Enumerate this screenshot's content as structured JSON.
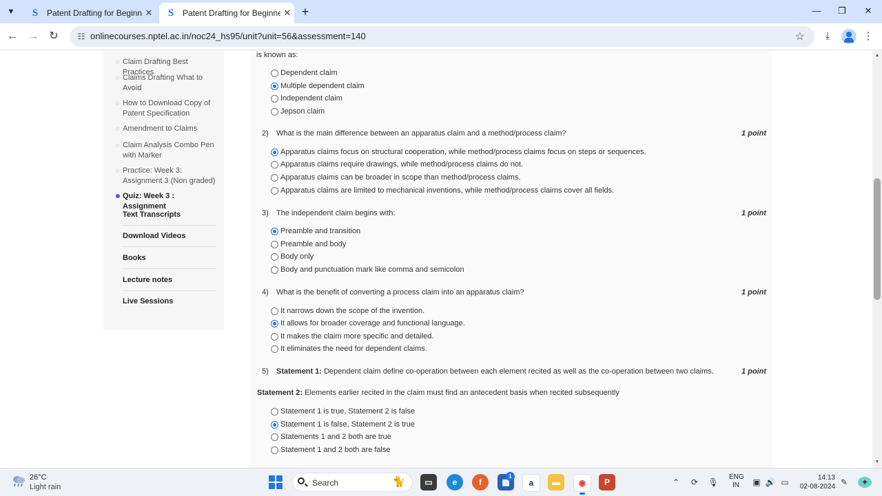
{
  "browser": {
    "tabs": [
      {
        "title": "Patent Drafting for Beginners -",
        "favicon": "S",
        "active": false
      },
      {
        "title": "Patent Drafting for Beginners -",
        "favicon": "S",
        "active": true
      }
    ],
    "url": "onlinecourses.nptel.ac.in/noc24_hs95/unit?unit=56&assessment=140",
    "accent_color": "#1a73e8"
  },
  "sidebar": {
    "subitems": [
      {
        "label": "Claim Drafting Best Practices",
        "active": false
      },
      {
        "label": "Claims Drafting What to Avoid",
        "active": false
      },
      {
        "label": "How to Download Copy of Patent Specification",
        "active": false
      },
      {
        "label": "Amendment to Claims",
        "active": false
      },
      {
        "label": "Claim Analysis Combo Pen with Marker",
        "active": false
      },
      {
        "label": "Practice: Week 3: Assignment 3 (Non graded)",
        "active": false
      },
      {
        "label": "Quiz: Week 3 : Assignment",
        "active": true
      }
    ],
    "sections": [
      "Text Transcripts",
      "Download Videos",
      "Books",
      "Lecture notes",
      "Live Sessions"
    ]
  },
  "quiz": {
    "partial_top": "is known as:",
    "q1_options": [
      {
        "text": "Dependent claim",
        "checked": false
      },
      {
        "text": "Multiple dependent claim",
        "checked": true
      },
      {
        "text": "Independent claim",
        "checked": false
      },
      {
        "text": "Jepson claim",
        "checked": false
      }
    ],
    "questions": [
      {
        "num": "2)",
        "text": "What is the main difference between an apparatus claim and a method/process claim?",
        "points": "1 point",
        "options": [
          {
            "text": "Apparatus claims focus on structural cooperation, while method/process claims focus on steps or sequences.",
            "checked": true
          },
          {
            "text": "Apparatus claims require drawings, while method/process claims do not.",
            "checked": false
          },
          {
            "text": "Apparatus claims can be broader in scope than method/process claims.",
            "checked": false
          },
          {
            "text": "Apparatus claims are limited to mechanical inventions, while method/process claims cover all fields.",
            "checked": false
          }
        ]
      },
      {
        "num": "3)",
        "text": "The independent claim begins with:",
        "points": "1 point",
        "options": [
          {
            "text": "Preamble and transition",
            "checked": true
          },
          {
            "text": "Preamble and body",
            "checked": false
          },
          {
            "text": "Body only",
            "checked": false
          },
          {
            "text": "Body and punctuation mark like comma and semicolon",
            "checked": false
          }
        ]
      },
      {
        "num": "4)",
        "text": "What is the benefit of converting a process claim into an apparatus claim?",
        "points": "1 point",
        "options": [
          {
            "text": "It narrows down the scope of the invention.",
            "checked": false
          },
          {
            "text": "It allows for broader coverage and functional language.",
            "checked": true
          },
          {
            "text": "It makes the claim more specific and detailed.",
            "checked": false
          },
          {
            "text": "It eliminates the need for dependent claims.",
            "checked": false
          }
        ]
      }
    ],
    "q5": {
      "num": "5)",
      "statement1_label": "Statement 1:",
      "statement1_text": "Dependent claim define co-operation between each element recited as well as the co-operation between two claims.",
      "points": "1 point",
      "statement2_label": "Statement 2:",
      "statement2_text": "Elements earlier recited in the claim must find an antecedent basis when recited subsequently",
      "options": [
        {
          "text": "Statement 1 is true, Statement 2 is false",
          "checked": false
        },
        {
          "text": "Statement 1 is false, Statement 2 is true",
          "checked": true
        },
        {
          "text": "Statements 1 and 2 both are true",
          "checked": false
        },
        {
          "text": "Statement 1 and 2 both are false",
          "checked": false
        }
      ]
    }
  },
  "taskbar": {
    "weather_temp": "26°C",
    "weather_desc": "Light rain",
    "search_label": "Search",
    "notification_count": "1",
    "lang_line1": "ENG",
    "lang_line2": "IN",
    "time": "14:13",
    "date": "02-08-2024"
  }
}
